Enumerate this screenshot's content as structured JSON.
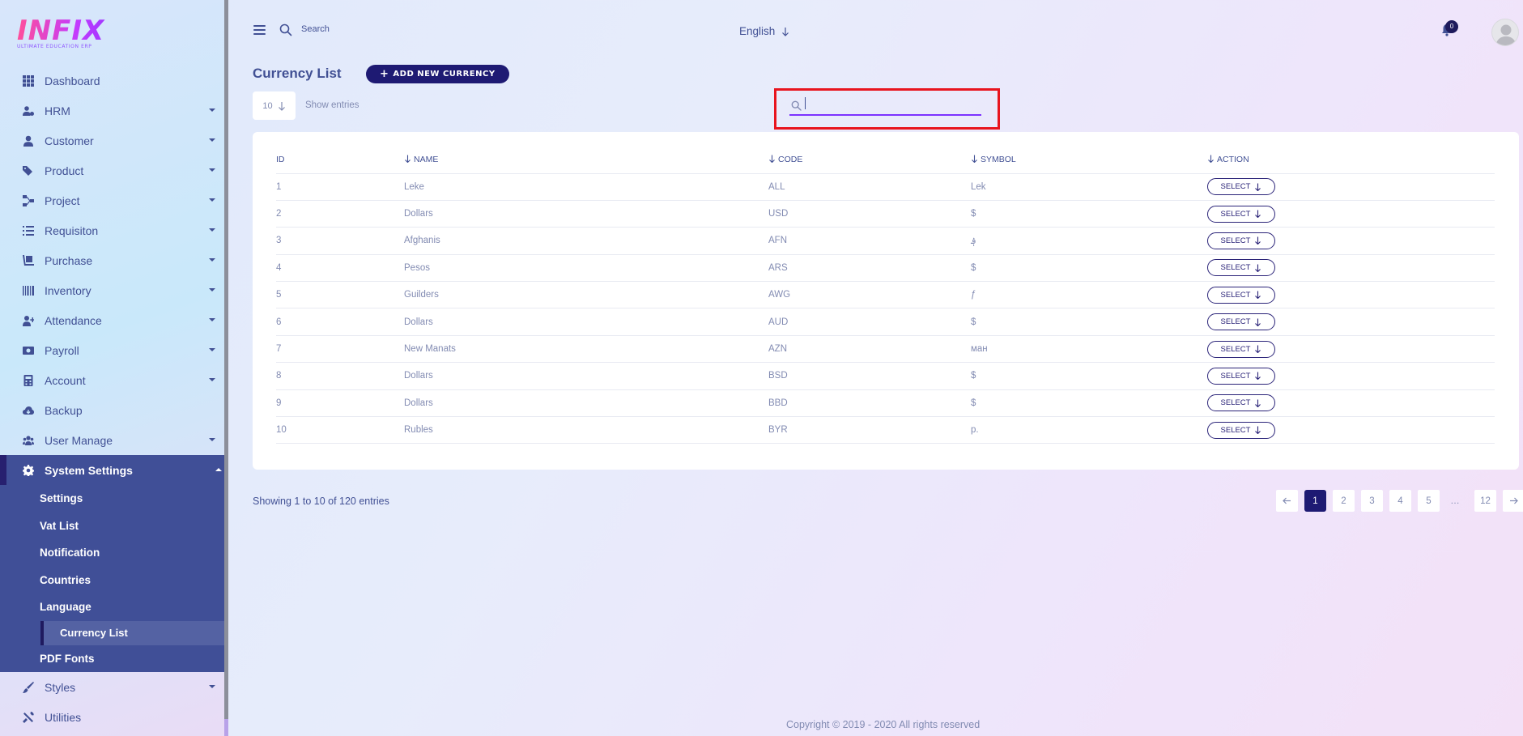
{
  "logo": {
    "text": "INFIX",
    "subtitle": "ULTIMATE EDUCATION ERP"
  },
  "sidebar": {
    "items": [
      {
        "label": "Dashboard",
        "icon": "grid-icon",
        "caret": false
      },
      {
        "label": "HRM",
        "icon": "users-cog-icon",
        "caret": true
      },
      {
        "label": "Customer",
        "icon": "user-icon",
        "caret": true
      },
      {
        "label": "Product",
        "icon": "tags-icon",
        "caret": true
      },
      {
        "label": "Project",
        "icon": "project-diagram-icon",
        "caret": true
      },
      {
        "label": "Requisiton",
        "icon": "list-icon",
        "caret": true
      },
      {
        "label": "Purchase",
        "icon": "dolly-icon",
        "caret": true
      },
      {
        "label": "Inventory",
        "icon": "barcode-icon",
        "caret": true
      },
      {
        "label": "Attendance",
        "icon": "user-plus-icon",
        "caret": true
      },
      {
        "label": "Payroll",
        "icon": "money-icon",
        "caret": true
      },
      {
        "label": "Account",
        "icon": "calculator-icon",
        "caret": true
      },
      {
        "label": "Backup",
        "icon": "cloud-download-icon",
        "caret": false
      },
      {
        "label": "User Manage",
        "icon": "users-icon",
        "caret": true
      }
    ],
    "system_settings": {
      "label": "System Settings",
      "icon": "gear-icon",
      "children": [
        "Settings",
        "Vat List",
        "Notification",
        "Countries",
        "Language",
        "Currency List",
        "PDF Fonts"
      ],
      "active_child": "Currency List"
    },
    "after_items": [
      {
        "label": "Styles",
        "icon": "brush-icon",
        "caret": true
      },
      {
        "label": "Utilities",
        "icon": "tools-icon",
        "caret": false
      }
    ]
  },
  "topbar": {
    "search_label": "Search",
    "language": "English",
    "notification_count": "0"
  },
  "main": {
    "title": "Currency List",
    "add_button": "ADD NEW CURRENCY",
    "entries_value": "10",
    "show_entries": "Show entries",
    "search_value": "",
    "table": {
      "headers": [
        "ID",
        "NAME",
        "CODE",
        "SYMBOL",
        "ACTION"
      ],
      "rows": [
        {
          "id": "1",
          "name": "Leke",
          "code": "ALL",
          "symbol": "Lek",
          "action": "SELECT"
        },
        {
          "id": "2",
          "name": "Dollars",
          "code": "USD",
          "symbol": "$",
          "action": "SELECT"
        },
        {
          "id": "3",
          "name": "Afghanis",
          "code": "AFN",
          "symbol": "؋",
          "action": "SELECT"
        },
        {
          "id": "4",
          "name": "Pesos",
          "code": "ARS",
          "symbol": "$",
          "action": "SELECT"
        },
        {
          "id": "5",
          "name": "Guilders",
          "code": "AWG",
          "symbol": "ƒ",
          "action": "SELECT"
        },
        {
          "id": "6",
          "name": "Dollars",
          "code": "AUD",
          "symbol": "$",
          "action": "SELECT"
        },
        {
          "id": "7",
          "name": "New Manats",
          "code": "AZN",
          "symbol": "ман",
          "action": "SELECT"
        },
        {
          "id": "8",
          "name": "Dollars",
          "code": "BSD",
          "symbol": "$",
          "action": "SELECT"
        },
        {
          "id": "9",
          "name": "Dollars",
          "code": "BBD",
          "symbol": "$",
          "action": "SELECT"
        },
        {
          "id": "10",
          "name": "Rubles",
          "code": "BYR",
          "symbol": "p.",
          "action": "SELECT"
        }
      ]
    },
    "showing": "Showing 1 to 10 of 120 entries",
    "pagination": [
      "1",
      "2",
      "3",
      "4",
      "5",
      "…",
      "12"
    ],
    "active_page": "1"
  },
  "footer": {
    "copyright": "Copyright © 2019 - 2020 All rights reserved"
  },
  "colors": {
    "primary": "#415094",
    "accent": "#7c32ff",
    "dark": "#1e1a73",
    "highlight_border": "#e8141e"
  }
}
